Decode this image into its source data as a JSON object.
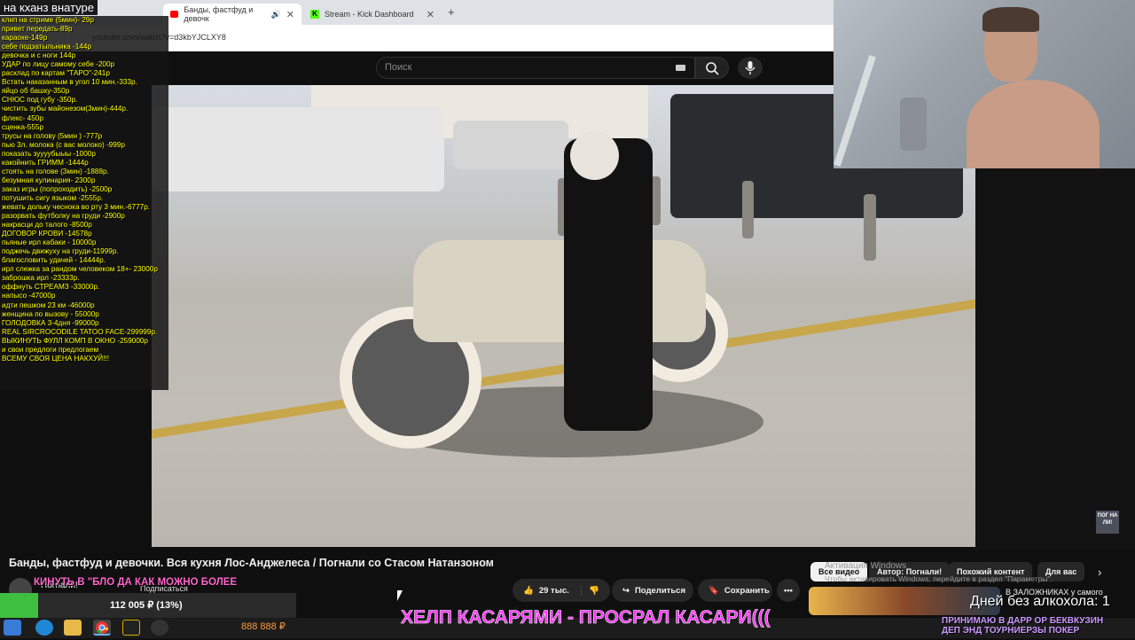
{
  "browser": {
    "tabs": [
      {
        "label": "Банды, фастфуд и девочк",
        "active": true
      },
      {
        "label": "Stream - Kick Dashboard",
        "active": false
      }
    ],
    "new_tab": "+",
    "url": "youtube.com/watch?v=d3kbYJCLXY8"
  },
  "youtube": {
    "search_placeholder": "Поиск",
    "video_title": "Банды, фастфуд и девочки. Вся кухня Лос-Анджелеса / Погнали со Стасом Натанзоном",
    "channel": "Погнали!",
    "subscribe": "Подписаться",
    "likes": "29 тыс.",
    "share": "Поделиться",
    "save": "Сохранить",
    "channel_logo": "ПОГ НА ЛИ!",
    "chips": [
      "Все видео",
      "Автор: Погнали!",
      "Похожий контент",
      "Для вас"
    ],
    "related_title": "В ЗАЛОЖНИКАХ у самого",
    "windows_watermark": "Активация Windows",
    "windows_watermark_sub": "Чтобы активировать Windows, перейдите в раздел \"Параметры\"."
  },
  "overlay": {
    "title": "на кханз внатуре",
    "price_list": [
      "клип на стриме (5мин)- 29р",
      "привет передать-89р",
      "караоке-149р",
      "себе подзатыльника -144р",
      "девочка и с ноги 144р",
      "УДАР по лицу самому себе -200р",
      "расклад по картам \"ТАРО\"-241р",
      "Встать наказанным в угол 10 мин.-333р.",
      "яйцо об башку-350р",
      "СНЮС под губу -350р.",
      "чистить зубы майонезом(3мин)-444р.",
      "флекс- 450р",
      "сценка-555р",
      "трусы на голову (5мин ) -777р",
      "пью 3л. молока (с вас молоко) -999р",
      "показать зуууубыыы -1000р",
      "какойнить ГРИММ -1444р",
      "стоять на голове (3мин) -1888р.",
      "безумная кулинария- 2300р",
      "заказ игры (попроходить) -2500р",
      "потушить сигу языком -2555р.",
      "жевать дольку чеснока во рту 3 мин.-6777р.",
      "разорвать футболку на груди -2900р",
      "накрасци до талого -8500р",
      "ДОГОВОР КРОВИ -14578р",
      "пьяные ирл кабаки - 10000р",
      "поджечь движуху на груди-11999р.",
      "благословить удачей - 14444р.",
      "ирл слежка за рандом человеком 18+- 23000р",
      "заброшка ирл -23333р.",
      "оффнуть СТРЕАМЗ -33000р.",
      "напысо -47000р",
      "идти пешком 23 км -46000р",
      "женщина по вызову - 55000р",
      "ГОЛОДОВКА 3-4дня -99000р",
      "REAL SIRCROCODILE TATOO FACE-299999р.",
      "ВЫКИНУТЬ ФУЛЛ КОМП В ОКНО -259000р",
      "и свои предлоги предлогаем",
      "ВСЕМУ СВОЯ ЦЕНА НАКХУЙ!!!"
    ],
    "donate_line": "КИНУТЬ В \"БЛО ДА КАК МОЖНО БОЛЕЕ",
    "goal_text": "112 005 ₽ (13%)",
    "goal_fraction": 0.13,
    "ticker": "ХЕЛП КАСАРЯМИ - ПРОСРАЛ КАСАРИ(((",
    "sober": "Дней без алкохола: 1",
    "promo_line1": "ПРИНИМАЮ В ДАРР ОР БЕКВКУЗИН",
    "promo_line2": "ДЕП ЭНД ТОУРНИЕРЗЫ ПОКЕР",
    "taskbar_number": "888 888 ₽",
    "colors": {
      "list_text": "#ffff00",
      "ticker": "#ff33ff",
      "goal_fill": "#3fbf3f"
    }
  }
}
